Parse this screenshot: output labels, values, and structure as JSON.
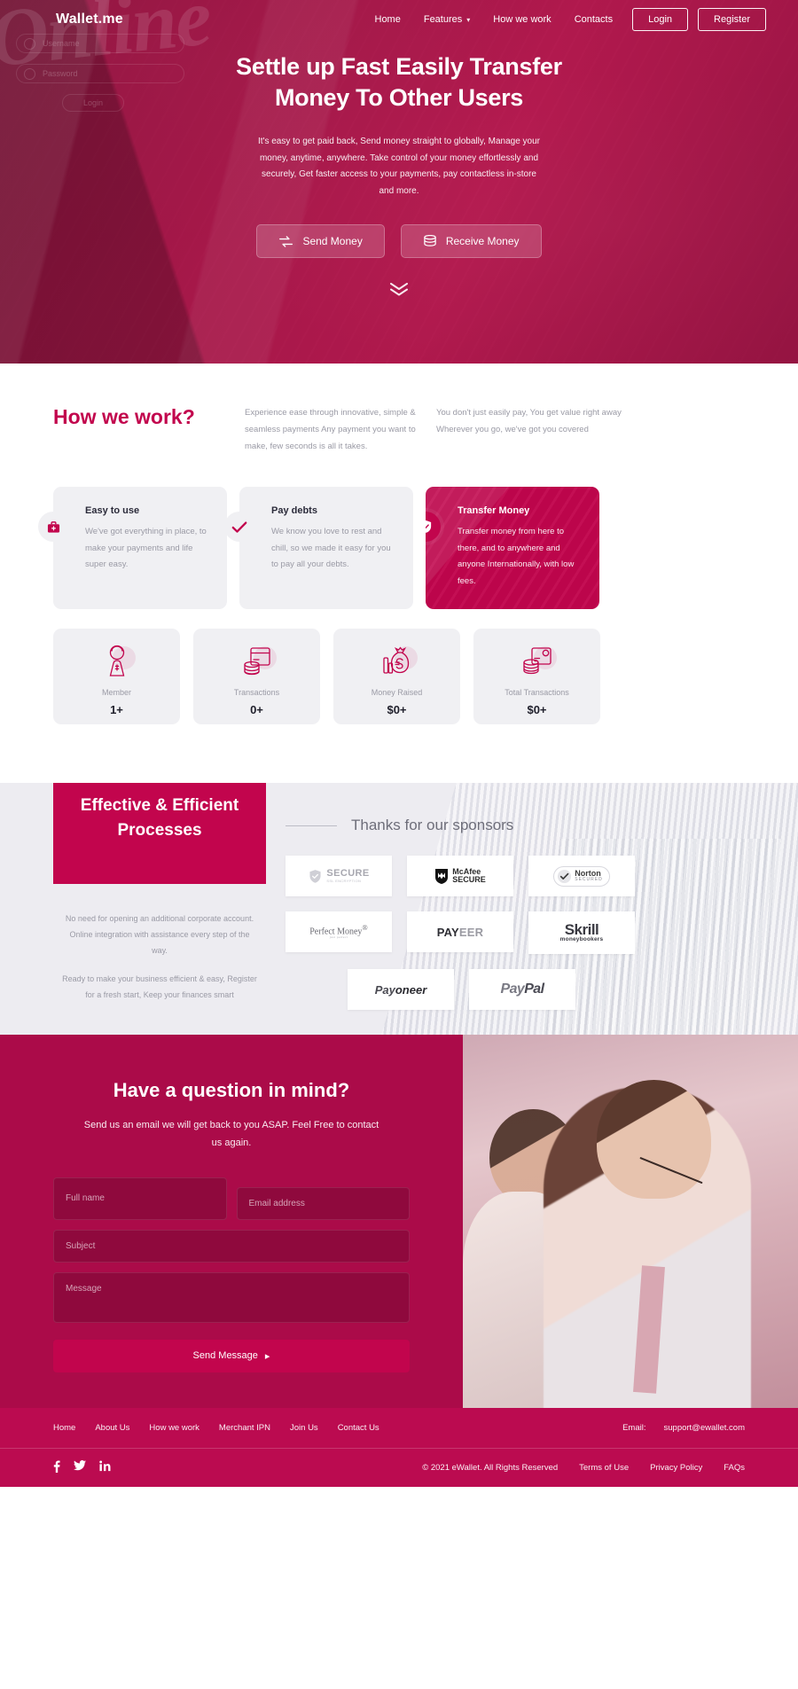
{
  "brand": {
    "logo_text": "Wallet.me",
    "accent": "#c2054d",
    "hero_bg": "#a8184a",
    "footer_bg": "#bb0b50"
  },
  "nav": {
    "links": [
      {
        "label": "Home",
        "icon": ""
      },
      {
        "label": "Features",
        "icon": "chevron-down-icon"
      },
      {
        "label": "How we work",
        "icon": ""
      },
      {
        "label": "Contacts",
        "icon": ""
      }
    ],
    "login_label": "Login",
    "register_label": "Register"
  },
  "hero": {
    "watermark": "Online",
    "ghost_username": "Username",
    "ghost_password": "Password",
    "ghost_button": "Login",
    "title": "Settle up Fast Easily Transfer Money To Other Users",
    "subtitle": "It's easy to get paid back, Send money straight to globally, Manage your money, anytime, anywhere. Take control of your money effortlessly and securely, Get faster access to your payments, pay contactless in-store and more.",
    "btn_send": "Send Money",
    "btn_receive": "Receive Money",
    "scroll_icon": "double-chevron-down-icon"
  },
  "how": {
    "title": "How we work?",
    "col2": "Experience ease through innovative, simple & seamless payments Any payment you want to make, few seconds is all it takes.",
    "col3": "You don't just easily pay, You get value right away Wherever you go, we've got you covered",
    "cards": [
      {
        "icon": "briefcase-icon",
        "title": "Easy to use",
        "text": "We've got everything in place, to make your payments and life super easy.",
        "active": false
      },
      {
        "icon": "check-icon",
        "title": "Pay debts",
        "text": "We know you love to rest and chill, so we made it easy for you to pay all your debts.",
        "active": false
      },
      {
        "icon": "shield-check-icon",
        "title": "Transfer Money",
        "text": "Transfer money from here to there, and to anywhere and anyone Internationally, with low fees.",
        "active": true
      }
    ],
    "stats": [
      {
        "icon": "member-icon",
        "label": "Member",
        "value": "1+"
      },
      {
        "icon": "transactions-icon",
        "label": "Transactions",
        "value": "0+"
      },
      {
        "icon": "money-bag-icon",
        "label": "Money Raised",
        "value": "$0+"
      },
      {
        "icon": "total-transactions-icon",
        "label": "Total Transactions",
        "value": "$0+"
      }
    ]
  },
  "sponsors": {
    "eff_title": "Effective & Efficient Processes",
    "eff_p1": "No need for opening an additional corporate account. Online integration with assistance every step of the way.",
    "eff_p2": "Ready to make your business efficient & easy, Register for a fresh start, Keep your finances smart",
    "heading": "Thanks for our sponsors",
    "logos": [
      {
        "name": "secure-ssl-logo",
        "main": "SECURE",
        "sub": "SSL ENCRYPTION"
      },
      {
        "name": "mcafee-secure-logo",
        "main": "McAfee",
        "sub": "SECURE"
      },
      {
        "name": "norton-secured-logo",
        "main": "Norton",
        "sub": "SECURED"
      },
      {
        "name": "perfect-money-logo",
        "main": "Perfect Money",
        "sub": "just perfect"
      },
      {
        "name": "payeer-logo",
        "main": "PAY",
        "sub": "EER"
      },
      {
        "name": "skrill-logo",
        "main": "Skrill",
        "sub": "moneybookers"
      },
      {
        "name": "payoneer-logo",
        "main": "Pay",
        "sub": "oneer"
      },
      {
        "name": "paypal-logo",
        "main": "Pay",
        "sub": "Pal"
      }
    ]
  },
  "contact": {
    "heading": "Have a question in mind?",
    "sub": "Send us an email we will get back to you ASAP. Feel Free to contact us again.",
    "ph_name": "Full name",
    "ph_email": "Email address",
    "ph_subject": "Subject",
    "ph_message": "Message",
    "submit": "Send Message"
  },
  "footer": {
    "links": [
      "Home",
      "About Us",
      "How we work",
      "Merchant IPN",
      "Join Us",
      "Contact Us"
    ],
    "email_label": "Email:",
    "email_value": "support@ewallet.com",
    "socials": [
      {
        "name": "facebook-icon",
        "glyph": "f"
      },
      {
        "name": "twitter-icon",
        "glyph": "ᵛ"
      },
      {
        "name": "linkedin-icon",
        "glyph": "in"
      }
    ],
    "copyright": "© 2021 eWallet. All Rights Reserved",
    "legal": [
      "Terms of Use",
      "Privacy Policy",
      "FAQs"
    ]
  }
}
